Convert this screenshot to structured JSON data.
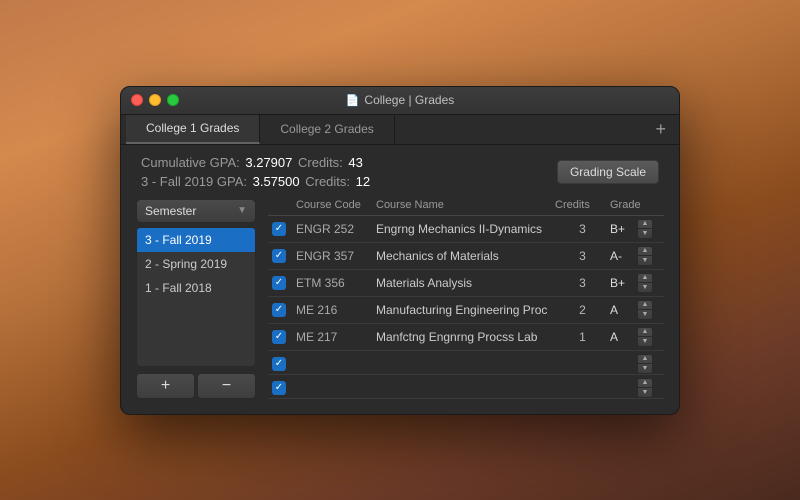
{
  "window": {
    "title": "College | Grades"
  },
  "tabs": [
    {
      "id": "tab-1",
      "label": "College 1 Grades",
      "active": true
    },
    {
      "id": "tab-2",
      "label": "College 2 Grades",
      "active": false
    }
  ],
  "stats": {
    "cumulative_label": "Cumulative GPA:",
    "cumulative_gpa": "3.27907",
    "cumulative_credits_label": "Credits:",
    "cumulative_credits": "43",
    "semester_label": "3 - Fall 2019 GPA:",
    "semester_gpa": "3.57500",
    "semester_credits_label": "Credits:",
    "semester_credits": "12",
    "grading_scale_btn": "Grading Scale"
  },
  "sidebar": {
    "dropdown_label": "Semester",
    "semesters": [
      {
        "id": "s3",
        "label": "3 - Fall 2019",
        "selected": true
      },
      {
        "id": "s2",
        "label": "2 - Spring 2019",
        "selected": false
      },
      {
        "id": "s1",
        "label": "1 - Fall 2018",
        "selected": false
      }
    ],
    "add_btn": "+",
    "remove_btn": "−"
  },
  "table": {
    "headers": [
      "",
      "Course Code",
      "Course Name",
      "Credits",
      "Grade"
    ],
    "rows": [
      {
        "checked": true,
        "code": "ENGR 252",
        "name": "Engrng Mechanics II-Dynamics",
        "credits": "3",
        "grade": "B+"
      },
      {
        "checked": true,
        "code": "ENGR 357",
        "name": "Mechanics of Materials",
        "credits": "3",
        "grade": "A-"
      },
      {
        "checked": true,
        "code": "ETM 356",
        "name": "Materials Analysis",
        "credits": "3",
        "grade": "B+"
      },
      {
        "checked": true,
        "code": "ME 216",
        "name": "Manufacturing Engineering Proc",
        "credits": "2",
        "grade": "A"
      },
      {
        "checked": true,
        "code": "ME 217",
        "name": "Manfctng Engnrng Procss Lab",
        "credits": "1",
        "grade": "A"
      },
      {
        "checked": true,
        "code": "",
        "name": "",
        "credits": "",
        "grade": ""
      },
      {
        "checked": true,
        "code": "",
        "name": "",
        "credits": "",
        "grade": ""
      }
    ]
  }
}
